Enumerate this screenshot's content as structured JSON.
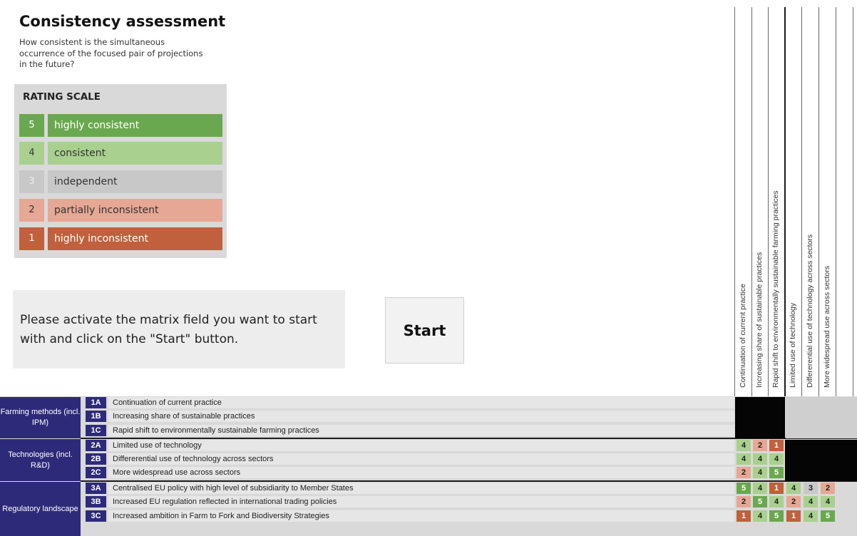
{
  "colors": {
    "highly_consistent": "#6aa84f",
    "consistent": "#a9d08e",
    "independent": "#c8c8c8",
    "partially_inconsistent": "#e6a794",
    "highly_inconsistent": "#c0603c",
    "group_header": "#2e2a7a"
  },
  "header": {
    "title": "Consistency assessment",
    "subtitle": "How consistent is the simultaneous occurrence of the focused pair of projections in the future?"
  },
  "rating_scale": {
    "title": "RATING SCALE",
    "items": [
      {
        "value": "5",
        "label": "highly consistent"
      },
      {
        "value": "4",
        "label": "consistent"
      },
      {
        "value": "3",
        "label": "independent"
      },
      {
        "value": "2",
        "label": "partially inconsistent"
      },
      {
        "value": "1",
        "label": "highly inconsistent"
      }
    ]
  },
  "instructions": {
    "text": "Please activate the matrix field you want to start with and click on the \"Start\" button.",
    "start_label": "Start"
  },
  "columns": [
    "Continuation of current practice",
    "Increasing share of sustainable practices",
    "Rapid shift to environmentally sustainable farming practices",
    "Limited use of technology",
    "Differerential use of technology across sectors",
    "More widespread use across sectors"
  ],
  "groups": [
    {
      "label": "Farming methods (incl. IPM)"
    },
    {
      "label": "Technologies (incl. R&D)"
    },
    {
      "label": "Regulatory landscape"
    }
  ],
  "rows": [
    {
      "code": "1A",
      "label": "Continuation of current practice"
    },
    {
      "code": "1B",
      "label": "Increasing share of sustainable practices"
    },
    {
      "code": "1C",
      "label": "Rapid shift to environmentally sustainable farming practices"
    },
    {
      "code": "2A",
      "label": "Limited use of technology"
    },
    {
      "code": "2B",
      "label": "Differerential use of technology across sectors"
    },
    {
      "code": "2C",
      "label": "More widespread use across sectors"
    },
    {
      "code": "3A",
      "label": "Centralised EU policy with high level of subsidiarity to Member States"
    },
    {
      "code": "3B",
      "label": "Increased EU regulation reflected in international trading policies"
    },
    {
      "code": "3C",
      "label": "Increased ambition in Farm to Fork and Biodiversity Strategies"
    }
  ],
  "matrix": {
    "2A": [
      "4",
      "2",
      "1"
    ],
    "2B": [
      "4",
      "4",
      "4"
    ],
    "2C": [
      "2",
      "4",
      "5"
    ],
    "3A": [
      "5",
      "4",
      "1",
      "4",
      "3",
      "2"
    ],
    "3B": [
      "2",
      "5",
      "4",
      "2",
      "4",
      "4"
    ],
    "3C": [
      "1",
      "4",
      "5",
      "1",
      "4",
      "5"
    ]
  }
}
